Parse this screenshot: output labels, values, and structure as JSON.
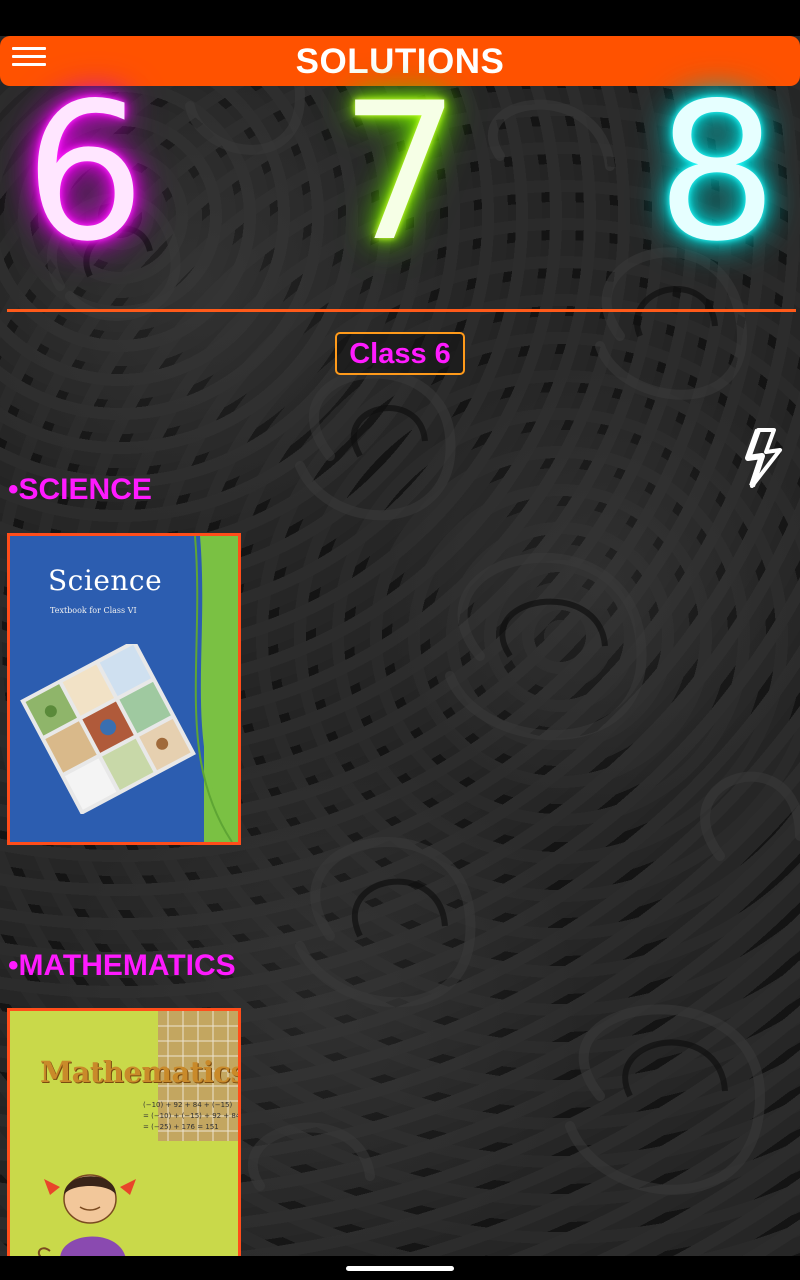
{
  "app_bar": {
    "title": "SOLUTIONS",
    "menu_icon": "hamburger-menu-icon",
    "color": "#ff5200"
  },
  "class_selector": {
    "digits": [
      {
        "label": "6",
        "glow_color": "#ff00ff"
      },
      {
        "label": "7",
        "glow_color": "#99ff00"
      },
      {
        "label": "8",
        "glow_color": "#00e5e5"
      }
    ]
  },
  "selected_class": {
    "label": "Class 6",
    "text_color": "#ff1aff",
    "border_color": "#ff9a1a"
  },
  "flash_icon": "lightning-bolt-icon",
  "subjects": [
    {
      "heading": "•SCIENCE",
      "book": {
        "cover_title": "Science",
        "cover_subtitle": "Textbook for Class VI"
      }
    },
    {
      "heading": "•MATHEMATICS",
      "book": {
        "cover_title": "Mathematics",
        "equations": [
          "(−10) + 92 + 84 + (−15)",
          "= (−10) + (−15) + 92 + 84",
          "= (−25) + 176 = 151"
        ]
      }
    }
  ],
  "accent_colors": {
    "heading_magenta": "#ff1aff",
    "divider_orange": "#ff5a1a",
    "book_border": "#ff4d1a"
  }
}
